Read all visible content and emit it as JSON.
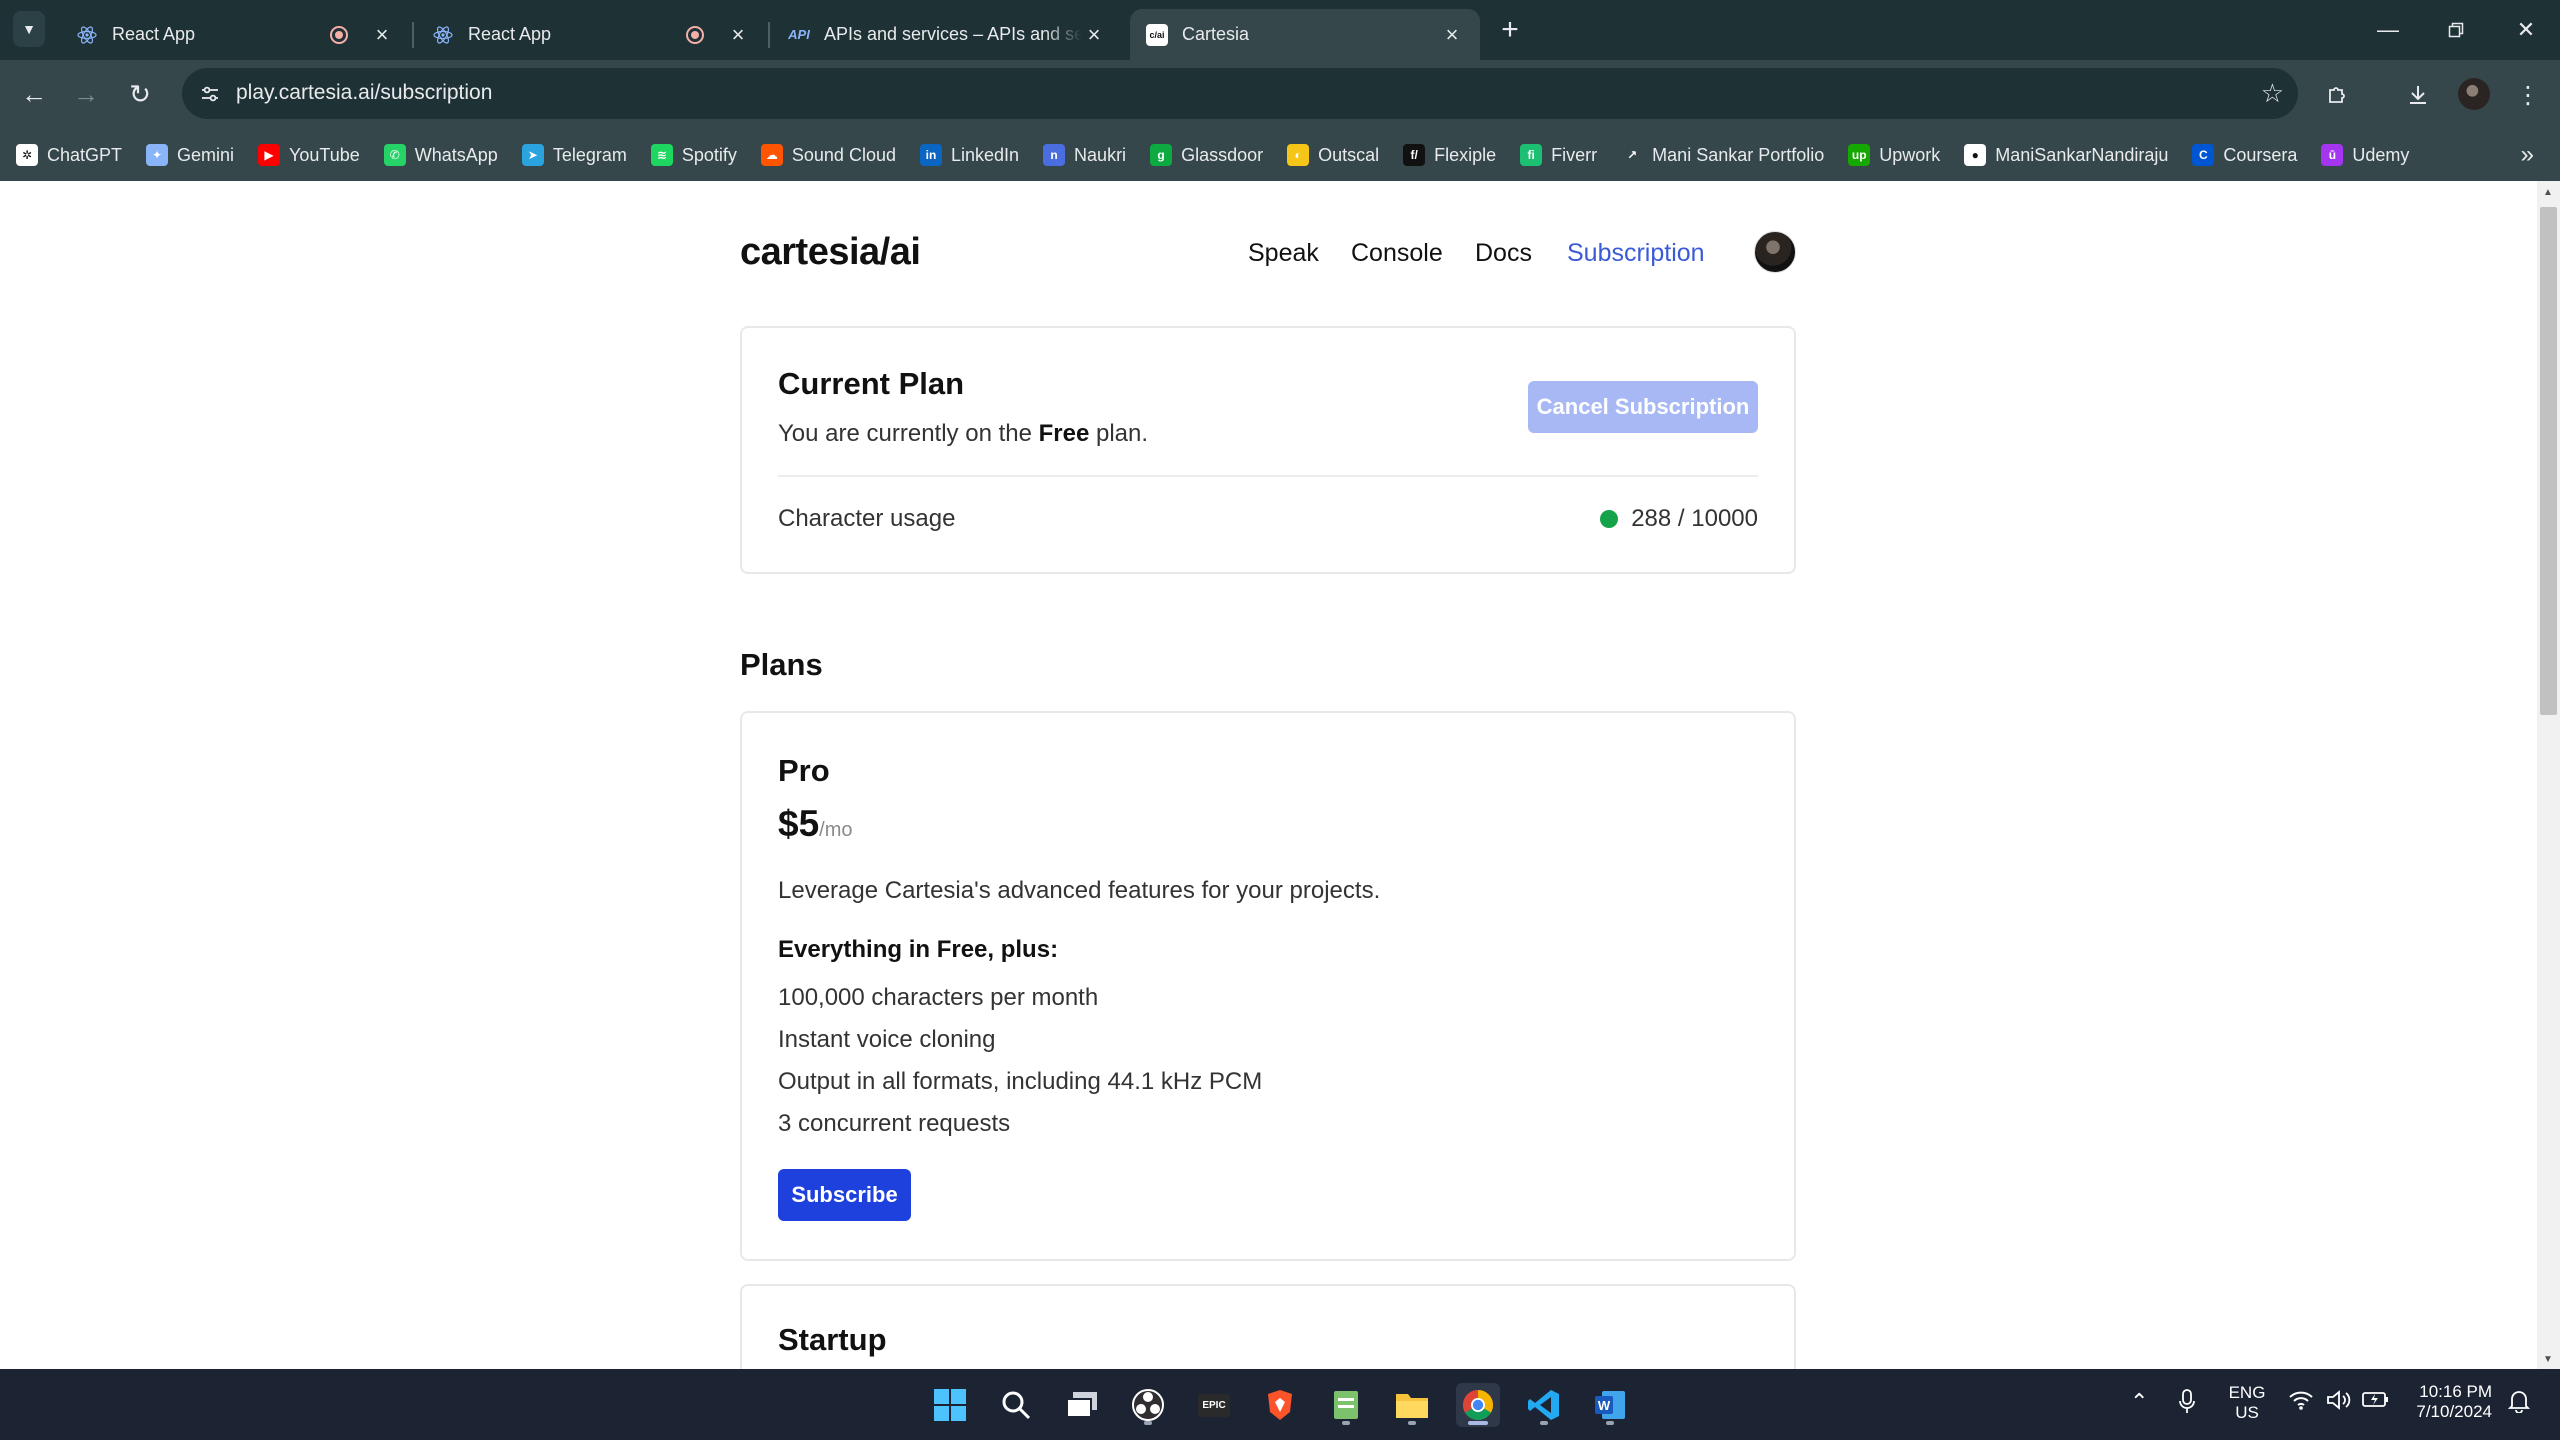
{
  "browser": {
    "tabs": [
      {
        "title": "React App",
        "icon": "react-icon",
        "recording": true
      },
      {
        "title": "React App",
        "icon": "react-icon",
        "recording": true
      },
      {
        "title": "APIs and services – APIs and services",
        "icon": "api-icon",
        "icon_text": "API"
      },
      {
        "title": "Cartesia",
        "icon": "cartesia-icon",
        "icon_text": "c/ai",
        "active": true
      }
    ],
    "url": "play.cartesia.ai/subscription",
    "bookmarks": [
      {
        "label": "ChatGPT",
        "icon": "chatgpt-icon",
        "color": "#ffffff"
      },
      {
        "label": "Gemini",
        "icon": "gemini-icon",
        "color": "#8ab4f8"
      },
      {
        "label": "YouTube",
        "icon": "youtube-icon",
        "color": "#ff0000"
      },
      {
        "label": "WhatsApp",
        "icon": "whatsapp-icon",
        "color": "#25d366"
      },
      {
        "label": "Telegram",
        "icon": "telegram-icon",
        "color": "#2aa3df"
      },
      {
        "label": "Spotify",
        "icon": "spotify-icon",
        "color": "#1ed760"
      },
      {
        "label": "Sound Cloud",
        "icon": "soundcloud-icon",
        "color": "#ff5500"
      },
      {
        "label": "LinkedIn",
        "icon": "linkedin-icon",
        "color": "#0a66c2"
      },
      {
        "label": "Naukri",
        "icon": "naukri-icon",
        "color": "#4a6ee0"
      },
      {
        "label": "Glassdoor",
        "icon": "glassdoor-icon",
        "color": "#0caa41"
      },
      {
        "label": "Outscal",
        "icon": "outscal-icon",
        "color": "#f5c518"
      },
      {
        "label": "Flexiple",
        "icon": "flexiple-icon",
        "color": "#111111"
      },
      {
        "label": "Fiverr",
        "icon": "fiverr-icon",
        "color": "#1dbf73"
      },
      {
        "label": "Mani Sankar Portfolio",
        "icon": "portfolio-icon",
        "color": "#35474a"
      },
      {
        "label": "Upwork",
        "icon": "upwork-icon",
        "color": "#14a800"
      },
      {
        "label": "ManiSankarNandiraju",
        "icon": "github-icon",
        "color": "#ffffff"
      },
      {
        "label": "Coursera",
        "icon": "coursera-icon",
        "color": "#0056d2"
      },
      {
        "label": "Udemy",
        "icon": "udemy-icon",
        "color": "#a435f0"
      }
    ]
  },
  "site": {
    "logo": "cartesia/ai",
    "nav": [
      {
        "label": "Speak"
      },
      {
        "label": "Console"
      },
      {
        "label": "Docs"
      },
      {
        "label": "Subscription",
        "active": true
      }
    ]
  },
  "current_plan": {
    "title": "Current Plan",
    "text_before": "You are currently on the ",
    "plan_name": "Free",
    "text_after": " plan.",
    "cancel_label": "Cancel Subscription",
    "usage_label": "Character usage",
    "usage_value": "288 / 10000",
    "usage_fraction": 0.0288,
    "status_color": "#15a34a"
  },
  "plans": {
    "title": "Plans",
    "items": [
      {
        "name": "Pro",
        "price": "$5",
        "period": "/mo",
        "description": "Leverage Cartesia's advanced features for your projects.",
        "features_heading": "Everything in Free, plus:",
        "features": [
          "100,000 characters per month",
          "Instant voice cloning",
          "Output in all formats, including 44.1 kHz PCM",
          "3 concurrent requests"
        ],
        "button": "Subscribe"
      },
      {
        "name": "Startup"
      }
    ]
  },
  "taskbar": {
    "apps": [
      "windows-start-icon",
      "search-icon",
      "task-view-icon",
      "obs-icon",
      "epic-games-icon",
      "brave-icon",
      "notepad-icon",
      "file-explorer-icon",
      "chrome-icon",
      "vscode-icon",
      "word-icon"
    ],
    "lang_top": "ENG",
    "lang_bottom": "US",
    "time": "10:16 PM",
    "date": "7/10/2024"
  },
  "colors": {
    "accent": "#1e40dd",
    "accent_disabled": "#a8b8f4",
    "nav_active": "#3b5bd6"
  }
}
